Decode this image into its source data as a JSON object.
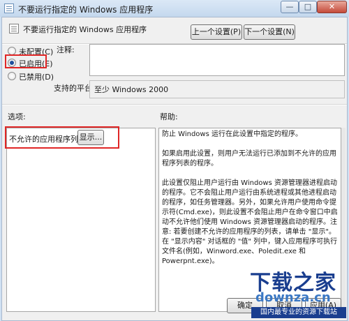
{
  "window": {
    "title": "不要运行指定的 Windows 应用程序",
    "min_glyph": "—",
    "max_glyph": "□",
    "close_glyph": "✕"
  },
  "header": {
    "title": "不要运行指定的 Windows 应用程序",
    "prev_label": "上一个设置(P)",
    "next_label": "下一个设置(N)"
  },
  "state": {
    "options": [
      {
        "label": "未配置(C)",
        "checked": false
      },
      {
        "label": "已启用(E)",
        "checked": true
      },
      {
        "label": "已禁用(D)",
        "checked": false
      }
    ]
  },
  "notes_label": "注释:",
  "platform": {
    "label": "支持的平台:",
    "value": "至少 Windows 2000"
  },
  "options_label": "选项:",
  "help_label": "帮助:",
  "options_pane": {
    "disallow_label": "不允许的应用程序列表",
    "show_button": "显示..."
  },
  "help": {
    "paragraphs": [
      "防止 Windows 运行在此设置中指定的程序。",
      "如果启用此设置，则用户无法运行已添加到不允许的应用程序列表的程序。",
      "此设置仅阻止用户运行由 Windows 资源管理器进程启动的程序。它不会阻止用户运行由系统进程或其他进程启动的程序，如任务管理器。另外，如果允许用户使用命令提示符(Cmd.exe)，则此设置不会阻止用户在命令窗口中启动不允许他们使用 Windows 资源管理器启动的程序。注意: 若要创建不允许的应用程序的列表，请单击 \"显示\"。在 \"显示内容\" 对话框的 \"值\" 列中，键入应用程序可执行文件名(例如，Winword.exe、Poledit.exe 和 Powerpnt.exe)。"
    ]
  },
  "footer": {
    "ok_label": "确定",
    "cancel_label": "取消",
    "apply_label": "应用(A)"
  },
  "watermark": {
    "title": "下载之家",
    "url": "downza.cn",
    "tagline": "国内最专业的资源下载站"
  },
  "colors": {
    "highlight_box": "#e02626",
    "titlebar": "#c4d8ee",
    "watermark_brand": "#1a3e8f"
  }
}
